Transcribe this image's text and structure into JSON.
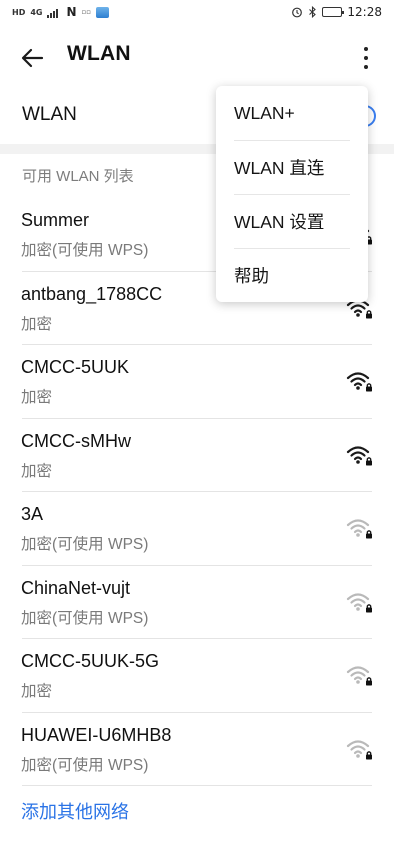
{
  "status_bar": {
    "left_tags": [
      "HD",
      "4G"
    ],
    "time": "12:28",
    "battery_fraction": 0.9
  },
  "header": {
    "title": "WLAN"
  },
  "wlan_toggle": {
    "label": "WLAN",
    "enabled": true
  },
  "section_header": "可用 WLAN 列表",
  "networks": [
    {
      "name": "Summer",
      "status": "加密(可使用 WPS)",
      "signal": "strong"
    },
    {
      "name": "antbang_1788CC",
      "status": "加密",
      "signal": "strong"
    },
    {
      "name": "CMCC-5UUK",
      "status": "加密",
      "signal": "strong"
    },
    {
      "name": "CMCC-sMHw",
      "status": "加密",
      "signal": "strong"
    },
    {
      "name": "3A",
      "status": "加密(可使用 WPS)",
      "signal": "weak"
    },
    {
      "name": "ChinaNet-vujt",
      "status": "加密(可使用 WPS)",
      "signal": "weak"
    },
    {
      "name": "CMCC-5UUK-5G",
      "status": "加密",
      "signal": "weak"
    },
    {
      "name": "HUAWEI-U6MHB8",
      "status": "加密(可使用 WPS)",
      "signal": "weak"
    }
  ],
  "add_network_label": "添加其他网络",
  "menu": {
    "items": [
      "WLAN+",
      "WLAN 直连",
      "WLAN 设置",
      "帮助"
    ]
  },
  "colors": {
    "accent": "#2a73e6",
    "toggle_on": "#3a7ef0",
    "signal_strong": "#1a1a1a",
    "signal_weak": "#b9b9b9"
  }
}
